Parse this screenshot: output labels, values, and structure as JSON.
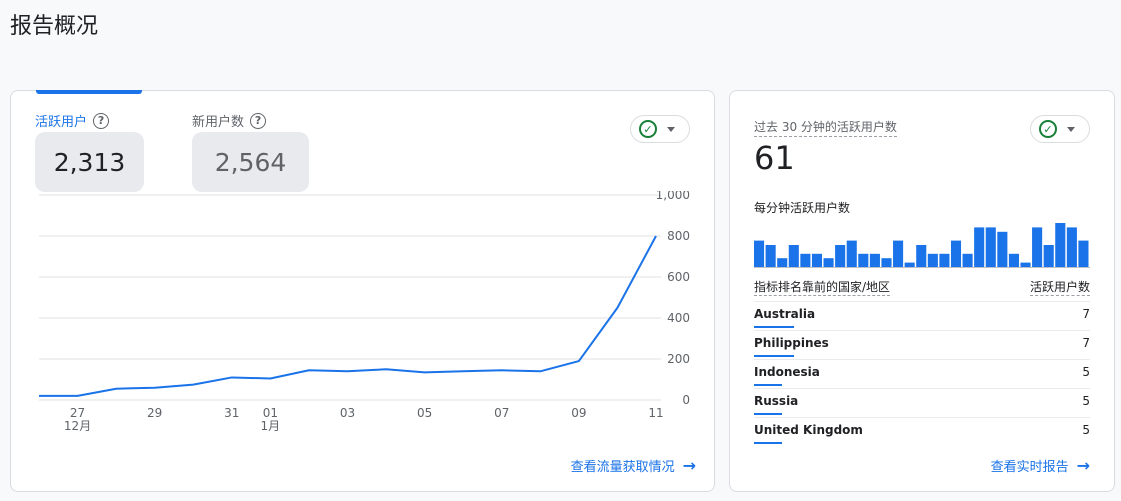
{
  "page": {
    "title": "报告概况"
  },
  "overview": {
    "metrics": [
      {
        "label": "活跃用户",
        "value": "2,313"
      },
      {
        "label": "新用户数",
        "value": "2,564"
      }
    ],
    "help_glyph": "?",
    "link_label": "查看流量获取情况",
    "chart_data": {
      "type": "line",
      "x": [
        "12-26",
        "12-27",
        "12-28",
        "12-29",
        "12-30",
        "12-31",
        "01-01",
        "01-02",
        "01-03",
        "01-04",
        "01-05",
        "01-06",
        "01-07",
        "01-08",
        "01-09",
        "01-10",
        "01-11"
      ],
      "series": [
        {
          "values": [
            20,
            20,
            55,
            60,
            75,
            110,
            105,
            145,
            140,
            150,
            135,
            140,
            145,
            140,
            190,
            450,
            800
          ]
        }
      ],
      "x_tick_labels": [
        {
          "x": "12-27",
          "label": "27",
          "sub": "12月"
        },
        {
          "x": "12-29",
          "label": "29",
          "sub": ""
        },
        {
          "x": "12-31",
          "label": "31",
          "sub": ""
        },
        {
          "x": "01-01",
          "label": "01",
          "sub": "1月"
        },
        {
          "x": "01-03",
          "label": "03",
          "sub": ""
        },
        {
          "x": "01-05",
          "label": "05",
          "sub": ""
        },
        {
          "x": "01-07",
          "label": "07",
          "sub": ""
        },
        {
          "x": "01-09",
          "label": "09",
          "sub": ""
        },
        {
          "x": "01-11",
          "label": "11",
          "sub": ""
        }
      ],
      "y_ticks": [
        "0",
        "200",
        "400",
        "600",
        "800",
        "1,000"
      ],
      "ylim": [
        0,
        1000
      ],
      "grid": true,
      "y_axis_position": "right",
      "color": "#1a73e8"
    }
  },
  "realtime": {
    "label": "过去 30 分钟的活跃用户数",
    "value": "61",
    "sublabel": "每分钟活跃用户数",
    "chart_data": {
      "type": "bar",
      "values": [
        6,
        5,
        2,
        5,
        3,
        3,
        2,
        5,
        6,
        3,
        3,
        2,
        6,
        1,
        5,
        3,
        3,
        6,
        3,
        9,
        9,
        8,
        3,
        1,
        9,
        5,
        10,
        9,
        6
      ],
      "color": "#1a73e8"
    },
    "table": {
      "col_country": "指标排名靠前的国家/地区",
      "col_users": "活跃用户数",
      "rows": [
        {
          "country": "Australia",
          "value": "7",
          "share": 1.0
        },
        {
          "country": "Philippines",
          "value": "7",
          "share": 1.0
        },
        {
          "country": "Indonesia",
          "value": "5",
          "share": 0.71
        },
        {
          "country": "Russia",
          "value": "5",
          "share": 0.71
        },
        {
          "country": "United Kingdom",
          "value": "5",
          "share": 0.71
        }
      ]
    },
    "link_label": "查看实时报告"
  },
  "icons": {
    "help": "help-circle-icon",
    "status": "check-circle-icon",
    "dropdown": "caret-down-icon",
    "arrow": "arrow-right-icon"
  },
  "colors": {
    "accent": "#1a73e8",
    "success": "#188038"
  }
}
